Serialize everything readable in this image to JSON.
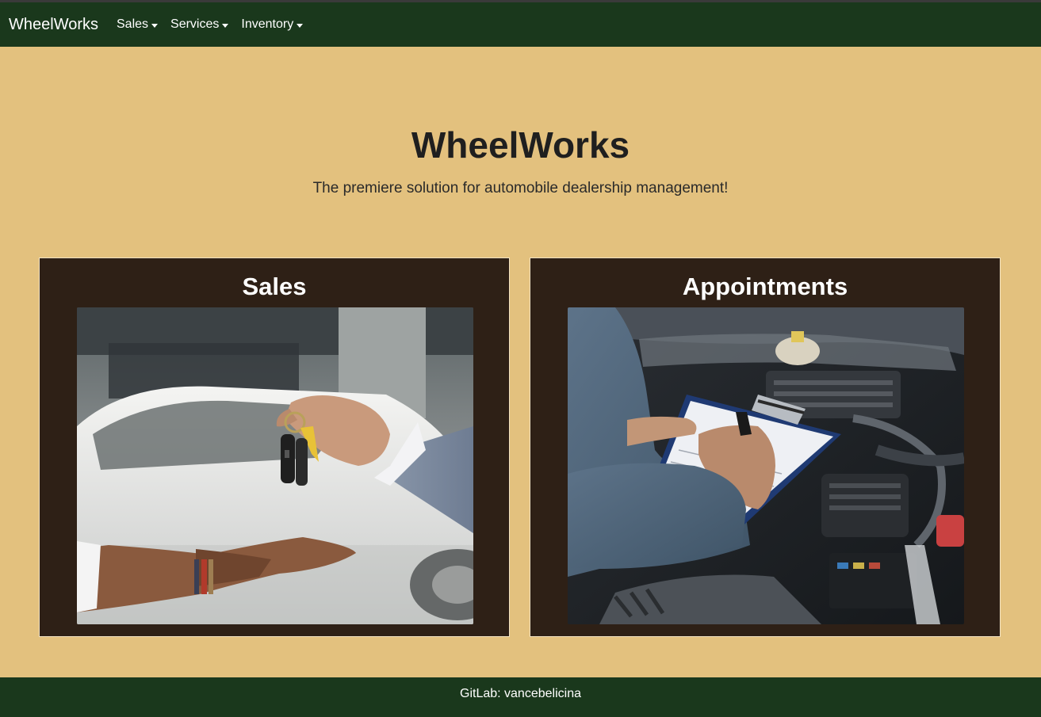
{
  "navbar": {
    "brand": "WheelWorks",
    "menus": [
      {
        "label": "Sales"
      },
      {
        "label": "Services"
      },
      {
        "label": "Inventory"
      }
    ]
  },
  "hero": {
    "title": "WheelWorks",
    "subtitle": "The premiere solution for automobile dealership management!"
  },
  "cards": [
    {
      "title": "Sales",
      "image": "car-keys-handover-photo"
    },
    {
      "title": "Appointments",
      "image": "mechanic-clipboard-engine-photo"
    }
  ],
  "footer": {
    "text": "GitLab: vancebelicina"
  },
  "colors": {
    "navbar": "#1a381c",
    "page_background": "#e3c17e",
    "card_background": "#2e2016"
  }
}
